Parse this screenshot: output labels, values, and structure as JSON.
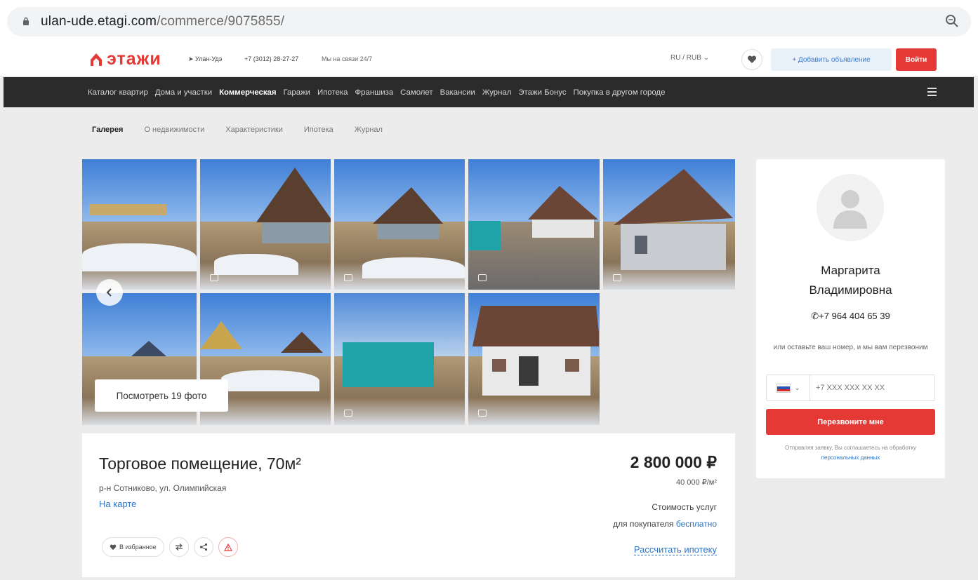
{
  "browser": {
    "url_host": "ulan-ude.etagi.com",
    "url_path": "/commerce/9075855/"
  },
  "header": {
    "logo_text": "этажи",
    "city": "Улан-Удэ",
    "phone": "+7 (3012) 28-27-27",
    "hours": "Мы на связи 24/7",
    "lang_currency": "RU / RUB",
    "add_listing_label": "+ Добавить объявление",
    "login_label": "Войти"
  },
  "nav": {
    "items": [
      "Каталог квартир",
      "Дома и участки",
      "Коммерческая",
      "Гаражи",
      "Ипотека",
      "Франшиза",
      "Самолет",
      "Вакансии",
      "Журнал",
      "Этажи Бонус",
      "Покупка в другом городе"
    ],
    "active_index": 2
  },
  "subtabs": {
    "items": [
      "Галерея",
      "О недвижимости",
      "Характеристики",
      "Ипотека",
      "Журнал"
    ],
    "active_index": 0
  },
  "gallery": {
    "view_all_label": "Посмотреть 19 фото",
    "visible_count": 9
  },
  "listing": {
    "title": "Торговое помещение, 70м²",
    "address": "р-н Сотниково, ул. Олимпийская",
    "map_link": "На карте",
    "price": "2 800 000 ₽",
    "price_per_m2": "40 000 ₽/м²",
    "service_cost_line1": "Стоимость услуг",
    "service_cost_line2": "для покупателя",
    "service_cost_free": "бесплатно",
    "mortgage_link": "Рассчитать ипотеку",
    "favorite_label": "В избранное"
  },
  "agent": {
    "name_line1": "Маргарита",
    "name_line2": "Владимировна",
    "phone": "+7 964 404 65 39",
    "callback_note": "или оставьте ваш номер, и мы вам перезвоним",
    "phone_placeholder": "+7 XXX XXX XX XX",
    "call_button_label": "Перезвоните мне",
    "consent_text": "Отправляя заявку, Вы соглашаетесь на обработку",
    "consent_link": "персональных данных"
  },
  "colors": {
    "brand_red": "#e53935",
    "nav_bg": "#2b2b2b",
    "link_blue": "#2f74c5",
    "page_bg": "#ececec"
  },
  "icons": [
    "lock-icon",
    "zoom-icon",
    "logo-house-icon",
    "location-arrow-icon",
    "heart-icon",
    "chevron-left-icon",
    "photo-icon",
    "compare-icon",
    "share-icon",
    "warning-icon",
    "user-avatar-icon",
    "phone-icon",
    "chevron-down-icon",
    "burger-menu-icon"
  ]
}
